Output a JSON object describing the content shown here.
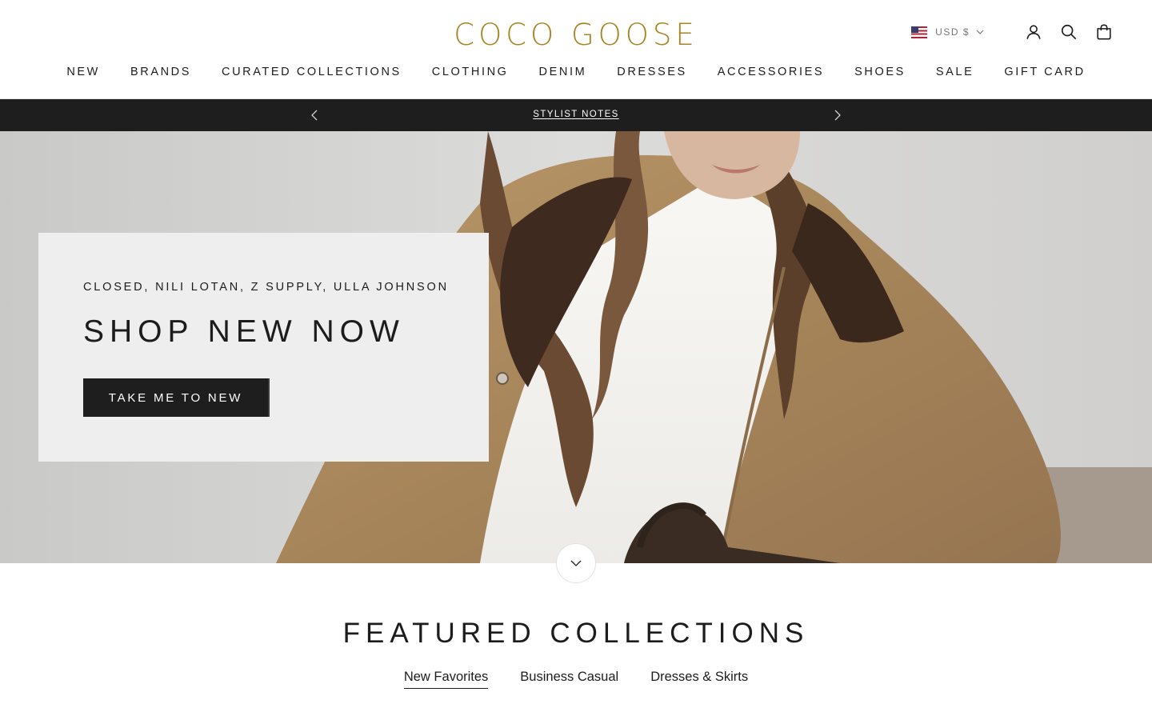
{
  "header": {
    "logo": "COCO GOOSE",
    "currency": {
      "flag_icon": "us-flag-icon",
      "label": "USD $"
    },
    "icons": [
      "account-icon",
      "search-icon",
      "cart-icon"
    ]
  },
  "nav": {
    "items": [
      "NEW",
      "BRANDS",
      "CURATED COLLECTIONS",
      "CLOTHING",
      "DENIM",
      "DRESSES",
      "ACCESSORIES",
      "SHOES",
      "SALE",
      "GIFT CARD"
    ]
  },
  "announcement": {
    "text": "STYLIST NOTES"
  },
  "hero": {
    "subtitle": "CLOSED, NILI LOTAN, Z SUPPLY, ULLA JOHNSON",
    "title": "SHOP NEW NOW",
    "button": "TAKE ME TO NEW"
  },
  "featured": {
    "title": "FEATURED COLLECTIONS",
    "tabs": [
      {
        "label": "New Favorites",
        "active": true
      },
      {
        "label": "Business Casual",
        "active": false
      },
      {
        "label": "Dresses & Skirts",
        "active": false
      }
    ]
  },
  "colors": {
    "brand_gold": "#a88524",
    "dark": "#1e1e1e",
    "card_bg": "#eeeeee"
  }
}
